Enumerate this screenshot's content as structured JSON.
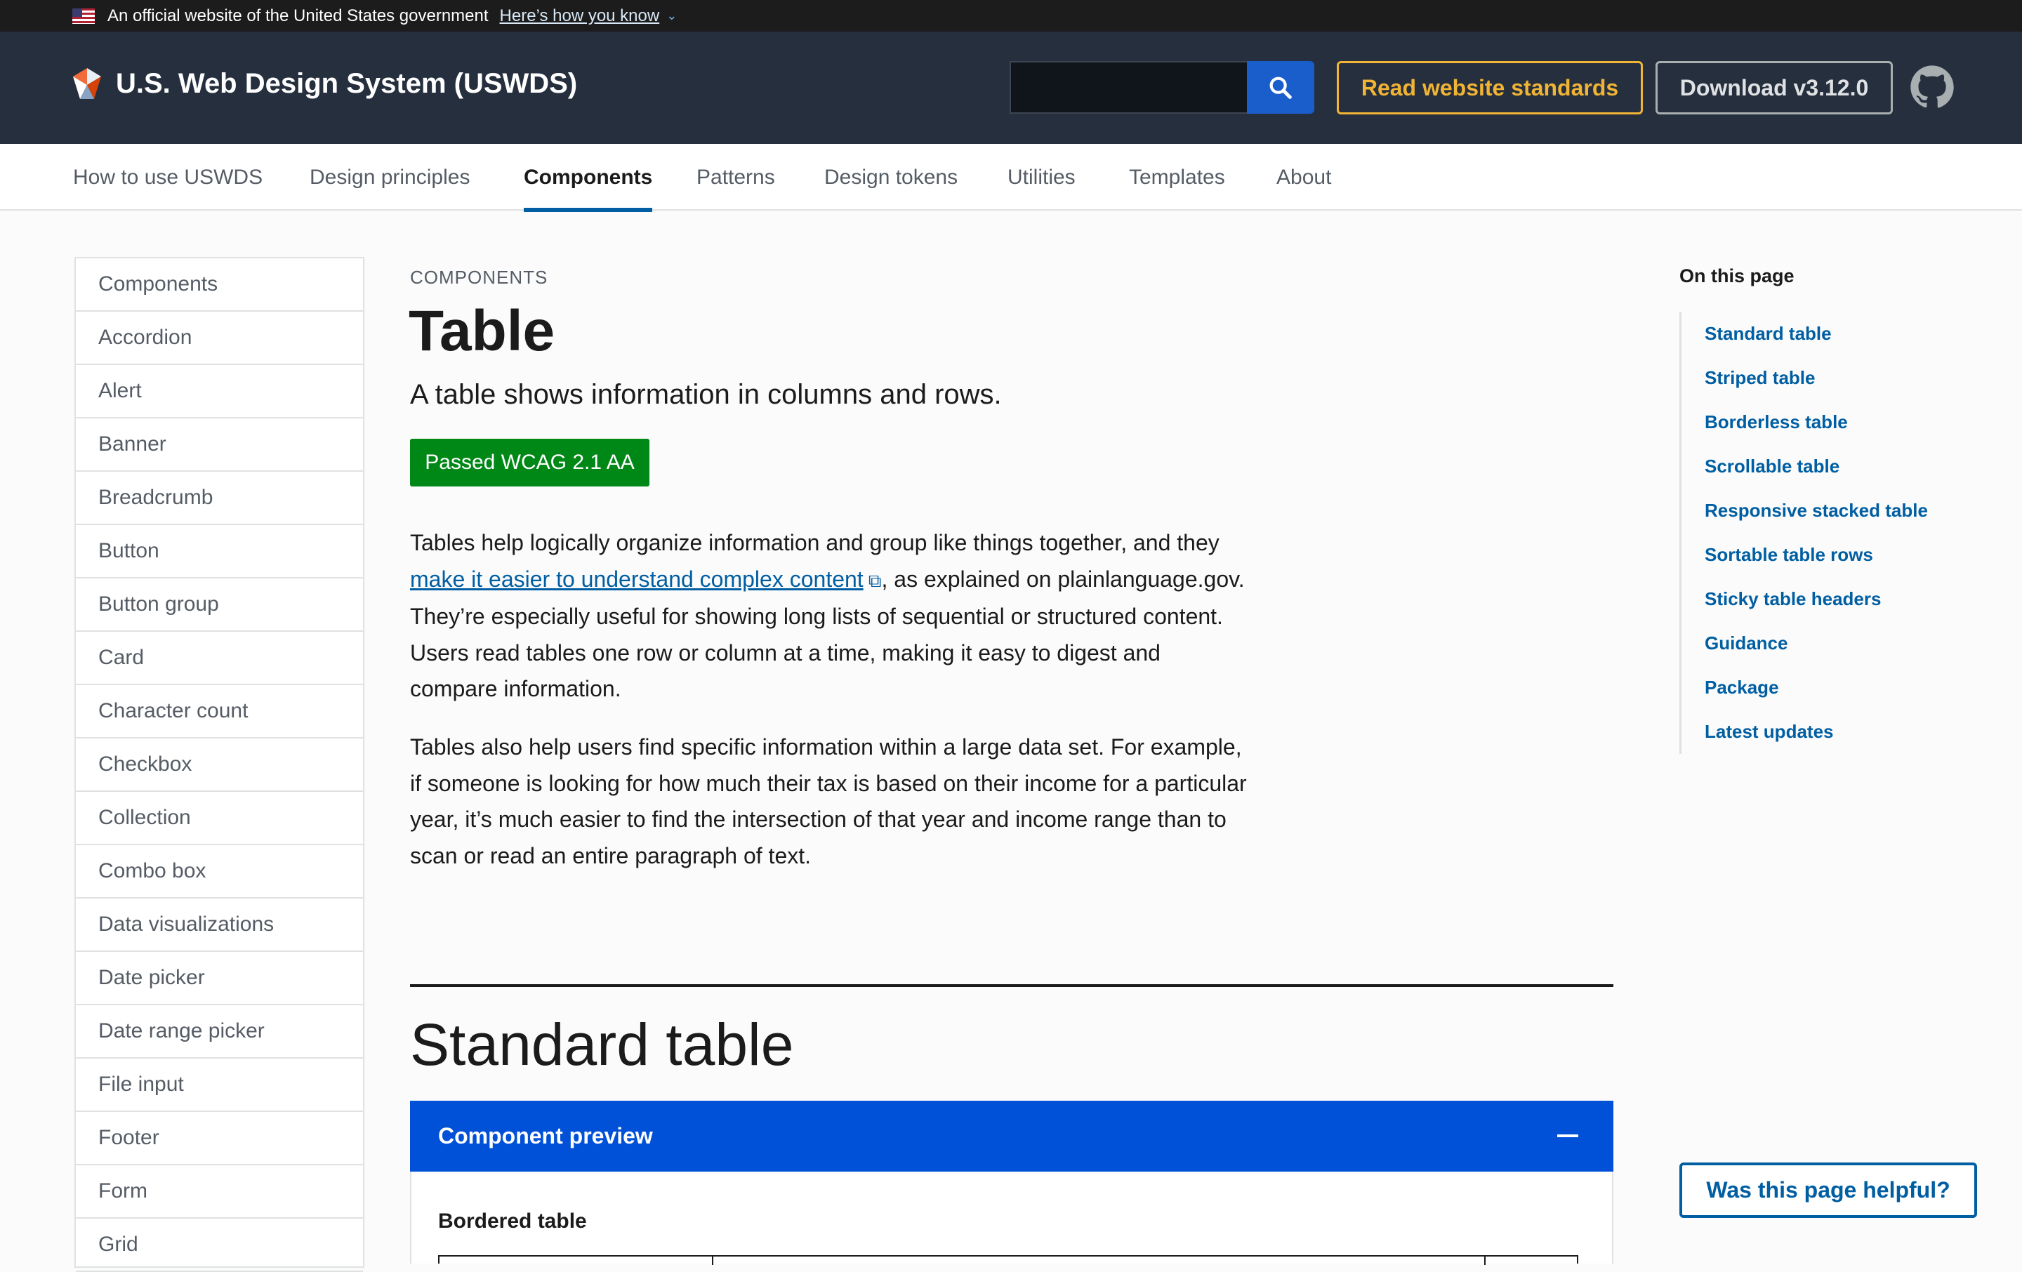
{
  "gov_banner": {
    "text": "An official website of the United States government",
    "link": "Here’s how you know"
  },
  "header": {
    "title": "U.S. Web Design System (USWDS)",
    "search_placeholder": "",
    "read_standards": "Read website standards",
    "download": "Download v3.12.0"
  },
  "nav": {
    "items": [
      "How to use USWDS",
      "Design principles",
      "Components",
      "Patterns",
      "Design tokens",
      "Utilities",
      "Templates",
      "About"
    ],
    "active": "Components"
  },
  "sidebar": {
    "items": [
      "Components",
      "Accordion",
      "Alert",
      "Banner",
      "Breadcrumb",
      "Button",
      "Button group",
      "Card",
      "Character count",
      "Checkbox",
      "Collection",
      "Combo box",
      "Data visualizations",
      "Date picker",
      "Date range picker",
      "File input",
      "Footer",
      "Form",
      "Grid"
    ]
  },
  "main": {
    "eyebrow": "COMPONENTS",
    "title": "Table",
    "lead": "A table shows information in columns and rows.",
    "badge": "Passed WCAG 2.1 AA",
    "p1_before": "Tables help logically organize information and group like things together, and they ",
    "p1_link": "make it easier to understand complex content",
    "p1_after": ", as explained on plainlanguage.gov. They’re especially useful for showing long lists of sequential or structured content. Users read tables one row or column at a time, making it easy to digest and compare information.",
    "p2": "Tables also help users find specific information within a large data set. For example, if someone is looking for how much their tax is based on their income for a particular year, it’s much easier to find the intersection of that year and income range than to scan or read an entire paragraph of text.",
    "section_title": "Standard table",
    "preview_label": "Component preview",
    "bordered_label": "Bordered table"
  },
  "on_this_page": {
    "title": "On this page",
    "items": [
      "Standard table",
      "Striped table",
      "Borderless table",
      "Scrollable table",
      "Responsive stacked table",
      "Sortable table rows",
      "Sticky table headers",
      "Guidance",
      "Package",
      "Latest updates"
    ]
  },
  "helpful": "Was this page helpful?",
  "colors": {
    "header_bg": "#252f3e",
    "accent_blue": "#005ea2",
    "preview_blue": "#0050d8",
    "badge_green": "#008817",
    "gold": "#f1b434"
  }
}
